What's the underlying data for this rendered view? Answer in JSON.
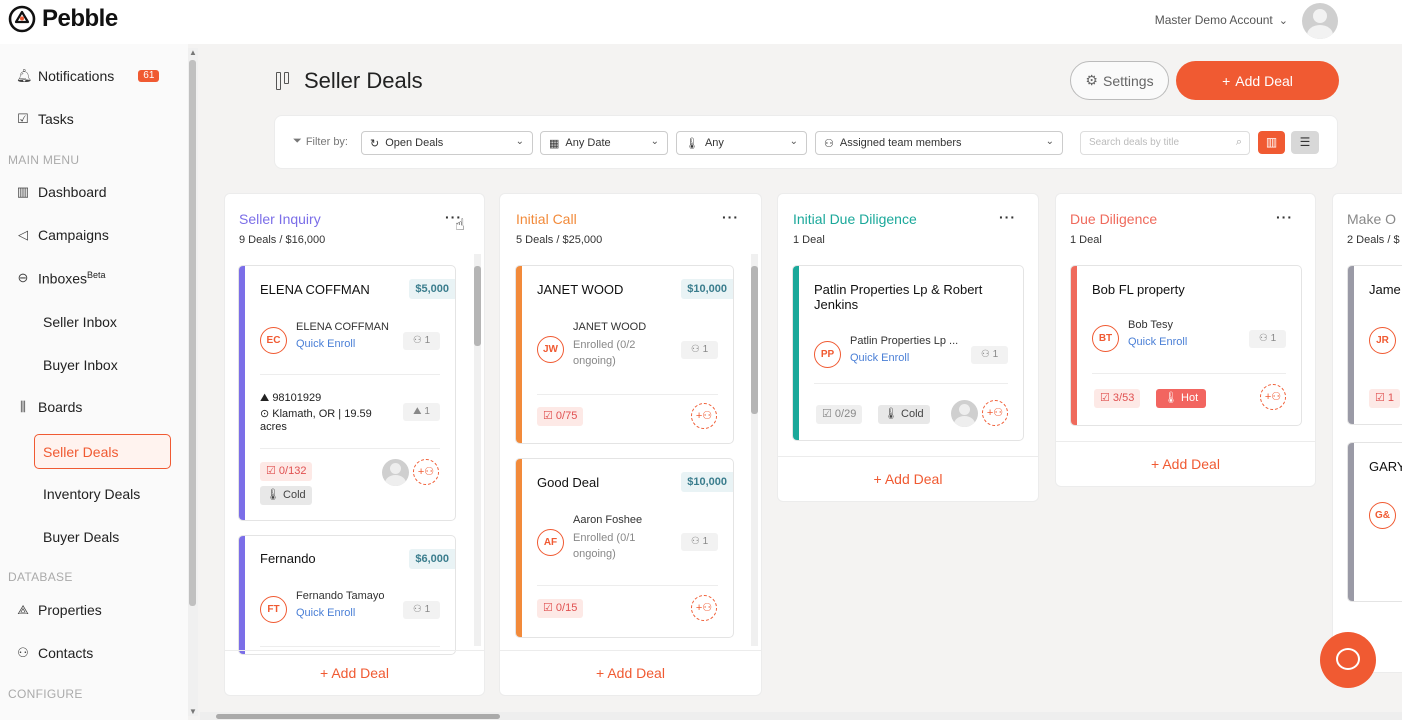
{
  "app": {
    "name": "Pebble"
  },
  "account": {
    "name": "Master Demo Account"
  },
  "sidebar": {
    "notifications": {
      "label": "Notifications",
      "badge": "61"
    },
    "tasks": "Tasks",
    "main_menu_heading": "MAIN MENU",
    "dashboard": "Dashboard",
    "campaigns": "Campaigns",
    "inboxes": {
      "label": "Inboxes",
      "tag": "Beta"
    },
    "seller_inbox": "Seller Inbox",
    "buyer_inbox": "Buyer Inbox",
    "boards": "Boards",
    "seller_deals": "Seller Deals",
    "inventory_deals": "Inventory Deals",
    "buyer_deals": "Buyer Deals",
    "database_heading": "DATABASE",
    "properties": "Properties",
    "contacts": "Contacts",
    "configure_heading": "CONFIGURE"
  },
  "header": {
    "title": "Seller Deals",
    "settings": "Settings",
    "add_deal": "Add Deal"
  },
  "filters": {
    "label": "Filter by:",
    "status": "Open Deals",
    "date": "Any Date",
    "temperature": "Any",
    "team": "Assigned team members",
    "search_placeholder": "Search deals by title"
  },
  "columns": [
    {
      "title": "Seller Inquiry",
      "color": "#7b6ee8",
      "summary": "9 Deals / $16,000",
      "add": "+ Add Deal",
      "cards": [
        {
          "title": "ELENA COFFMAN",
          "price": "$5,000",
          "initials": "EC",
          "contact": "ELENA COFFMAN",
          "link": "Quick Enroll",
          "count": "1",
          "zip": "98101929",
          "address": "Klamath, OR | 19.59 acres",
          "prop_count": "1",
          "tasks": "0/132",
          "temp": "Cold"
        },
        {
          "title": "Fernando",
          "price": "$6,000",
          "initials": "FT",
          "contact": "Fernando Tamayo",
          "link": "Quick Enroll",
          "count": "1"
        }
      ]
    },
    {
      "title": "Initial Call",
      "color": "#f28a3a",
      "summary": "5 Deals / $25,000",
      "add": "+ Add Deal",
      "cards": [
        {
          "title": "JANET WOOD",
          "price": "$10,000",
          "initials": "JW",
          "contact": "JANET WOOD",
          "status": "Enrolled (0/2 ongoing)",
          "count": "1",
          "tasks": "0/75"
        },
        {
          "title": "Good Deal",
          "price": "$10,000",
          "initials": "AF",
          "contact": "Aaron Foshee",
          "status": "Enrolled (0/1 ongoing)",
          "count": "1",
          "tasks": "0/15"
        }
      ]
    },
    {
      "title": "Initial Due Diligence",
      "color": "#1aa89a",
      "summary": "1 Deal",
      "add": "+ Add Deal",
      "cards": [
        {
          "title": "Patlin Properties Lp & Robert Jenkins",
          "initials": "PP",
          "contact": "Patlin Properties Lp ...",
          "link": "Quick Enroll",
          "count": "1",
          "tasks": "0/29",
          "temp": "Cold"
        }
      ]
    },
    {
      "title": "Due Diligence",
      "color": "#ef6a5c",
      "summary": "1 Deal",
      "add": "+ Add Deal",
      "cards": [
        {
          "title": "Bob FL property",
          "initials": "BT",
          "contact": "Bob Tesy",
          "link": "Quick Enroll",
          "count": "1",
          "tasks": "3/53",
          "temp": "Hot"
        }
      ]
    },
    {
      "title": "Make O",
      "color": "#9a9aa6",
      "summary": "2 Deals / $",
      "add": "",
      "cards": [
        {
          "title": "Jame",
          "initials": "JR",
          "tasks": "1"
        },
        {
          "title": "GARY",
          "initials": "G&"
        }
      ]
    }
  ]
}
